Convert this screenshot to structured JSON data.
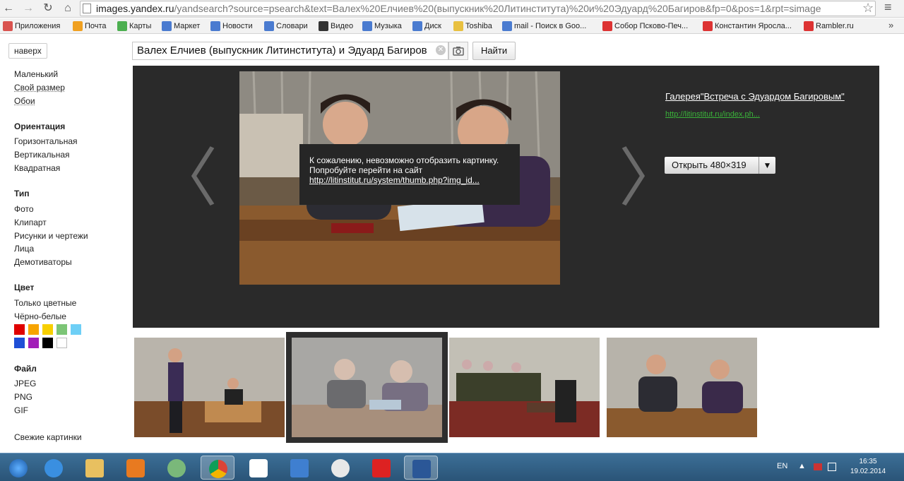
{
  "browser": {
    "url_host": "images.yandex.ru",
    "url_path": "/yandsearch?source=psearch&text=Валех%20Елчиев%20(выпускник%20Литинститута)%20и%20Эдуард%20Багиров&fp=0&pos=1&rpt=simage"
  },
  "bookmarks": [
    {
      "label": "Приложения",
      "color": "#d9534f"
    },
    {
      "label": "Почта",
      "color": "#f0a020"
    },
    {
      "label": "Карты",
      "color": "#4caf50"
    },
    {
      "label": "Маркет",
      "color": "#4a7bd0"
    },
    {
      "label": "Новости",
      "color": "#4a7bd0"
    },
    {
      "label": "Словари",
      "color": "#4a7bd0"
    },
    {
      "label": "Видео",
      "color": "#333333"
    },
    {
      "label": "Музыка",
      "color": "#4a7bd0"
    },
    {
      "label": "Диск",
      "color": "#4a7bd0"
    },
    {
      "label": "Toshiba",
      "color": "#e8c040"
    },
    {
      "label": "mail - Поиск в Goo...",
      "color": "#4a7bd0"
    },
    {
      "label": "Собор Псково-Печ...",
      "color": "#d33"
    },
    {
      "label": "Константин Яросла...",
      "color": "#d33"
    },
    {
      "label": "Rambler.ru",
      "color": "#d33"
    }
  ],
  "search": {
    "top_button": "наверх",
    "query": "Валех Елчиев (выпускник Литинститута) и Эдуард Багиров",
    "clear_glyph": "✕",
    "find_label": "Найти"
  },
  "sidebar": {
    "size_items": [
      "Маленький",
      "Свой размер",
      "Обои"
    ],
    "orientation_title": "Ориентация",
    "orientation_items": [
      "Горизонтальная",
      "Вертикальная",
      "Квадратная"
    ],
    "type_title": "Тип",
    "type_items": [
      "Фото",
      "Клипарт",
      "Рисунки и чертежи",
      "Лица",
      "Демотиваторы"
    ],
    "color_title": "Цвет",
    "color_items": [
      "Только цветные",
      "Чёрно-белые"
    ],
    "swatches": [
      "#e00000",
      "#f7a400",
      "#f7cf00",
      "#7cc576",
      "#6ecff6",
      "#1f4fd6",
      "#a21eb8",
      "#000000",
      "#ffffff"
    ],
    "file_title": "Файл",
    "file_items": [
      "JPEG",
      "PNG",
      "GIF"
    ],
    "fresh": "Свежие картинки"
  },
  "viewer": {
    "prev_glyph": "〈",
    "next_glyph": "〉",
    "error_line1": "К сожалению, невозможно отобразить картинку.",
    "error_line2": "Попробуйте перейти на сайт",
    "error_link": "http://litinstitut.ru/system/thumb.php?img_id...",
    "title": "Галерея\"Встреча с Эдуардом Багировым\"",
    "source_url": "http://litinstitut.ru/index.ph...",
    "open_label": "Открыть 480×319",
    "dropdown_glyph": "▼"
  },
  "taskbar": {
    "lang": "EN",
    "time": "16:35",
    "date": "19.02.2014"
  }
}
